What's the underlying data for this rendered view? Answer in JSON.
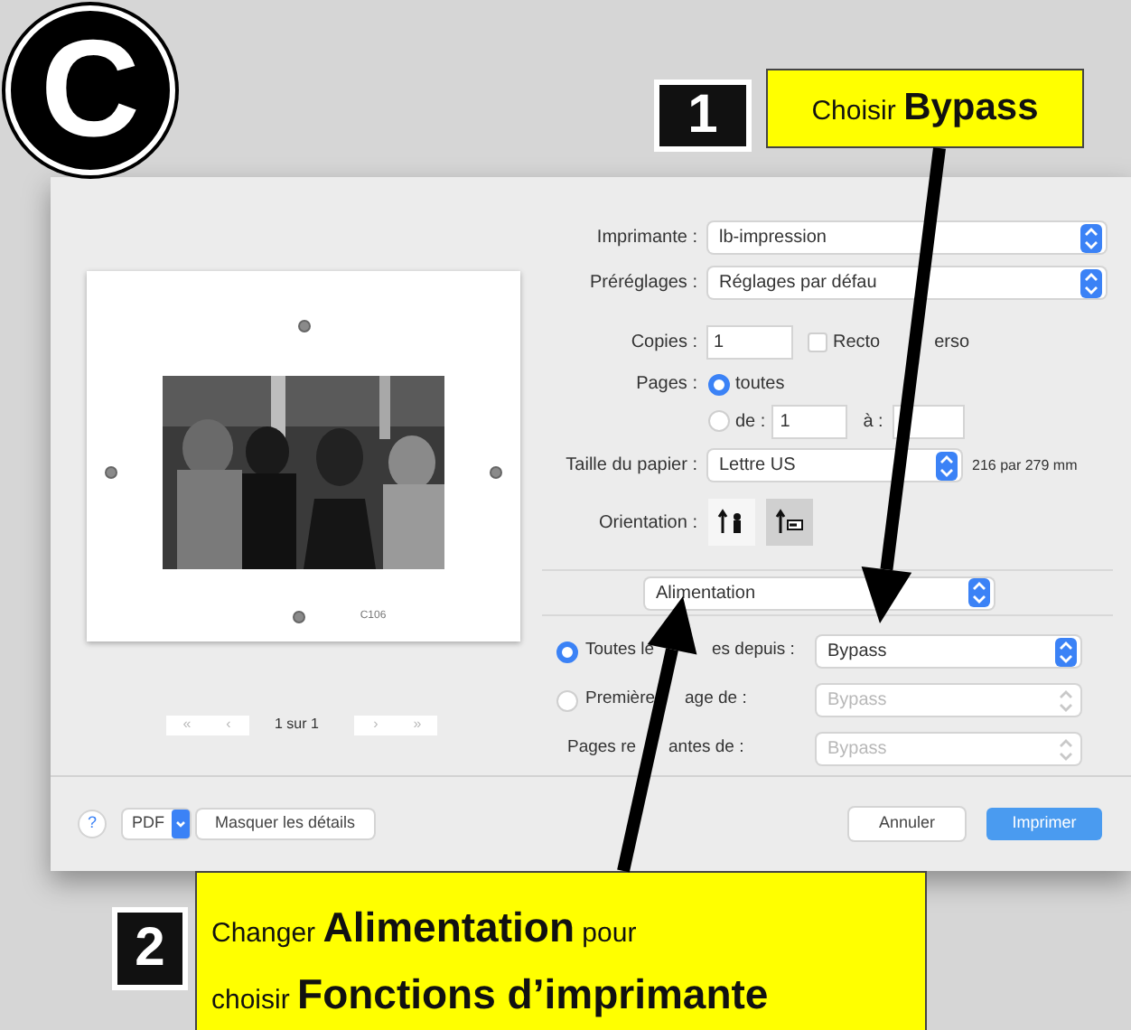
{
  "badge": {
    "letter": "C"
  },
  "callouts": [
    {
      "number": "1",
      "lines": [
        "Choisir **Bypass**"
      ]
    },
    {
      "number": "2",
      "lines": [
        "Changer **Alimentation** pour",
        "choisir **Fonctions d’imprimante**"
      ]
    }
  ],
  "preview": {
    "caption": "C106",
    "nav_back": [
      "«",
      "‹"
    ],
    "page_label": "1 sur 1",
    "nav_forward": [
      "›",
      "»"
    ]
  },
  "form": {
    "printer": {
      "label": "Imprimante :",
      "value": "lb-impression"
    },
    "presets": {
      "label": "Préréglages :",
      "value": "Réglages par défau"
    },
    "copies": {
      "label": "Copies :",
      "value": "1",
      "duplex": {
        "label_parts": [
          "Recto",
          "erso"
        ],
        "checked": false
      }
    },
    "pages": {
      "label": "Pages :",
      "options": [
        {
          "label": "toutes",
          "selected": true
        },
        {
          "label": "de :",
          "selected": false,
          "from": "1",
          "to_label": "à :"
        }
      ]
    },
    "paper": {
      "label": "Taille du papier :",
      "value": "Lettre US",
      "note": "216 par 279 mm"
    },
    "orientation": {
      "label": "Orientation :",
      "options": [
        {
          "kind": "portrait",
          "selected": false
        },
        {
          "kind": "landscape",
          "selected": true
        }
      ]
    },
    "section": {
      "value": "Alimentation"
    },
    "sources": [
      {
        "kind": "radio",
        "selected": true,
        "label_parts": [
          "Toutes le",
          "es depuis :"
        ],
        "value": "Bypass",
        "disabled": false
      },
      {
        "kind": "radio",
        "selected": false,
        "label_parts": [
          "Première",
          "age de :"
        ],
        "value": "Bypass",
        "disabled": true
      },
      {
        "kind": "plain",
        "label_parts": [
          "Pages re",
          "antes de :"
        ],
        "value": "Bypass",
        "disabled": true
      }
    ]
  },
  "footer": {
    "help": "?",
    "pdf": "PDF",
    "details": "Masquer les détails",
    "cancel": "Annuler",
    "print": "Imprimer"
  }
}
